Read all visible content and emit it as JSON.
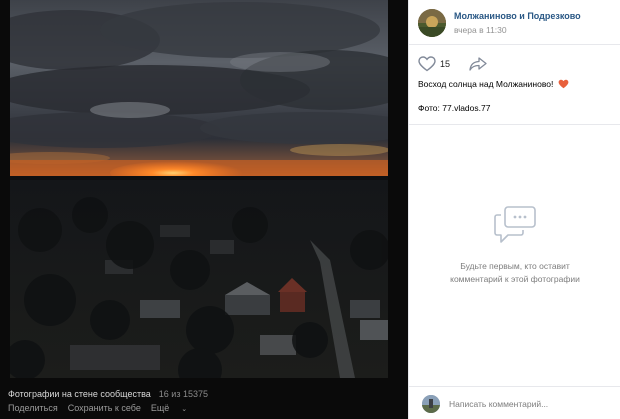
{
  "photo": {
    "description_icon": "sunset-photo"
  },
  "footer": {
    "album_title": "Фотографии на стене сообщества",
    "counter": "16 из 15375",
    "share_label": "Поделиться",
    "save_label": "Сохранить к себе",
    "more_label": "Ещё"
  },
  "author": {
    "name": "Молжаниново и Подрезково",
    "date": "вчера в 11:30"
  },
  "likes": {
    "count": "15",
    "icon": "heart-icon",
    "share_icon": "share-arrow-icon"
  },
  "post": {
    "caption": "Восход солнца над Молжаниново!",
    "credit": "Фото: 77.vlados.77"
  },
  "comments": {
    "empty_text_line1": "Будьте первым, кто оставит",
    "empty_text_line2": "комментарий к этой фотографии",
    "placeholder": "Написать комментарий..."
  },
  "colors": {
    "link": "#2a5885",
    "caption_heart": "#e8603c",
    "viewer_bg": "#0a0a0a"
  }
}
